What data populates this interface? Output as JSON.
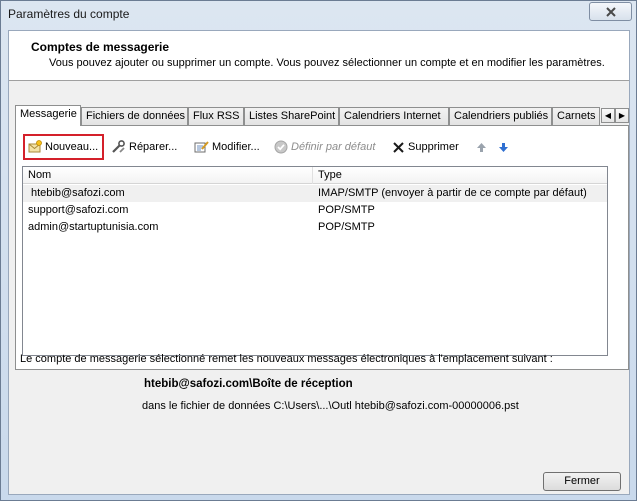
{
  "window": {
    "title": "Paramètres du compte"
  },
  "header": {
    "title": "Comptes de messagerie",
    "description": "Vous pouvez ajouter ou supprimer un compte. Vous pouvez sélectionner un compte et en modifier les paramètres."
  },
  "tabs": [
    {
      "label": "Messagerie",
      "active": true
    },
    {
      "label": "Fichiers de données",
      "active": false
    },
    {
      "label": "Flux RSS",
      "active": false
    },
    {
      "label": "Listes SharePoint",
      "active": false
    },
    {
      "label": "Calendriers Internet",
      "active": false
    },
    {
      "label": "Calendriers publiés",
      "active": false
    },
    {
      "label": "Carnets d'adresses",
      "active": false
    }
  ],
  "toolbar": {
    "new_label": "Nouveau...",
    "repair_label": "Réparer...",
    "modify_label": "Modifier...",
    "default_label": "Définir par défaut",
    "delete_label": "Supprimer"
  },
  "accounts": {
    "columns": {
      "name": "Nom",
      "type": "Type"
    },
    "rows": [
      {
        "name": "htebib@safozi.com",
        "type": "IMAP/SMTP (envoyer à partir de ce compte par défaut)",
        "selected": true
      },
      {
        "name": "support@safozi.com",
        "type": "POP/SMTP",
        "selected": false
      },
      {
        "name": "admin@startuptunisia.com",
        "type": "POP/SMTP",
        "selected": false
      }
    ]
  },
  "info": {
    "text": "Le compte de messagerie sélectionné remet les nouveaux messages électroniques à l'emplacement suivant :",
    "location": "htebib@safozi.com\\Boîte de réception",
    "file": "dans le fichier de données C:\\Users\\...\\Outl htebib@safozi.com-00000006.pst"
  },
  "footer": {
    "close_label": "Fermer"
  },
  "colors": {
    "highlight_border": "#d4202a",
    "arrow_up": "#9aa3ad",
    "arrow_down": "#2f6fd1"
  }
}
